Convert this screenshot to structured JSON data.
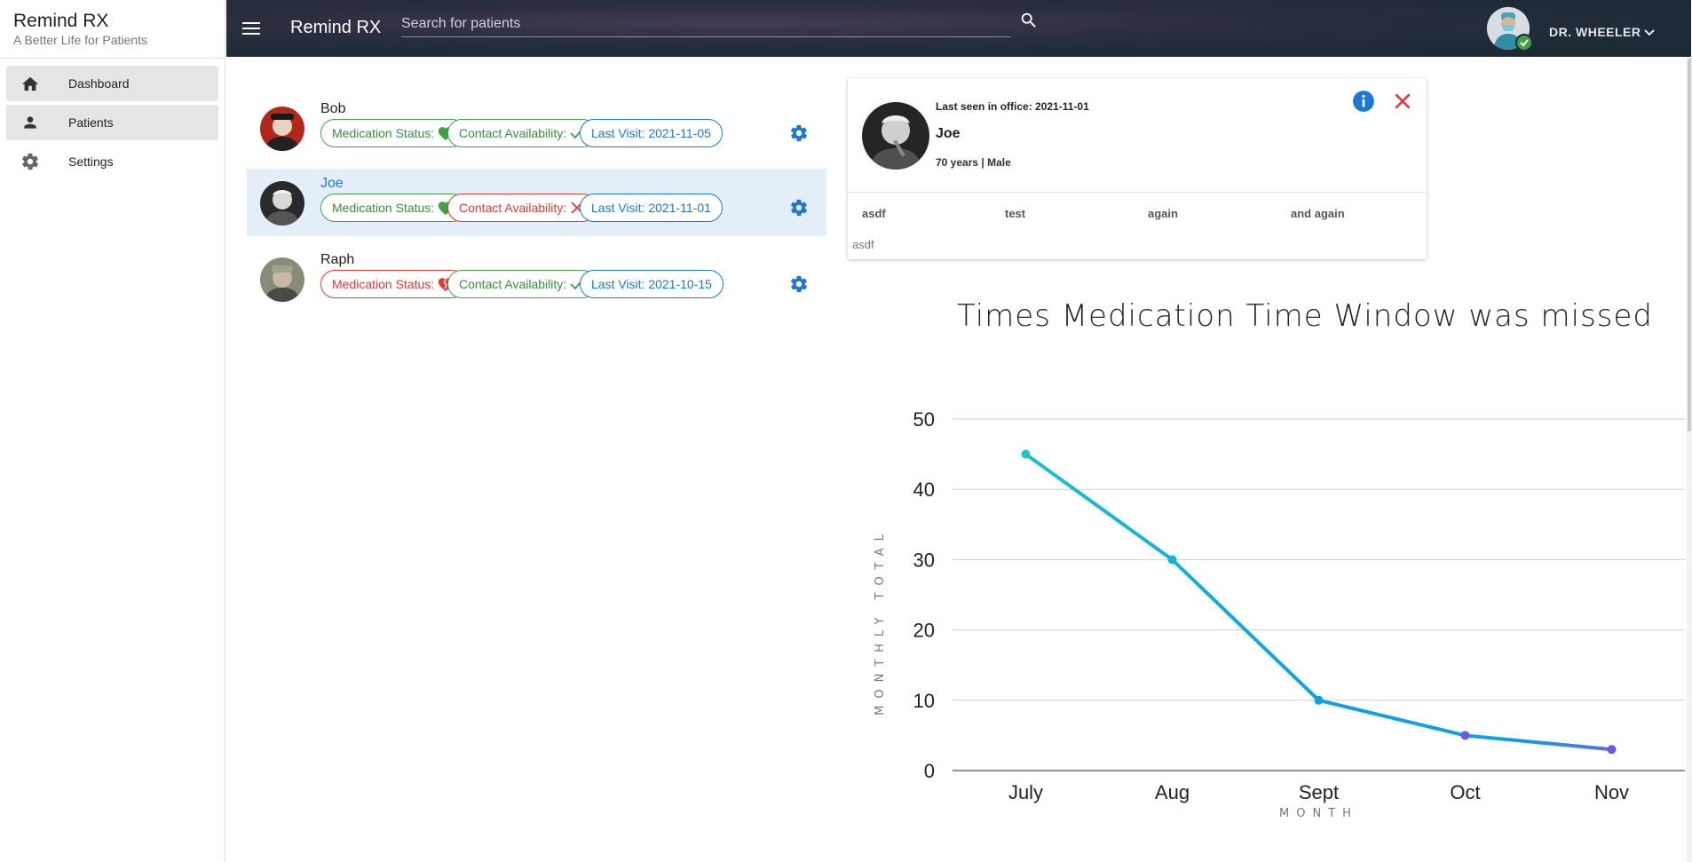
{
  "app": {
    "title": "Remind RX",
    "subtitle": "A Better Life for Patients"
  },
  "sidebar": {
    "items": [
      {
        "label": "Dashboard",
        "icon": "home-icon",
        "active": true
      },
      {
        "label": "Patients",
        "icon": "person-icon",
        "active": true
      },
      {
        "label": "Settings",
        "icon": "gear-icon",
        "active": false
      }
    ]
  },
  "topbar": {
    "title": "Remind RX",
    "search_placeholder": "Search for patients",
    "user_name": "DR. WHEELER"
  },
  "patients": [
    {
      "name": "Bob",
      "medication_label": "Medication Status:",
      "medication_ok": true,
      "contact_label": "Contact Availability:",
      "contact_ok": true,
      "last_visit": "Last Visit: 2021-11-05",
      "selected": false
    },
    {
      "name": "Joe",
      "medication_label": "Medication Status:",
      "medication_ok": true,
      "contact_label": "Contact Availability:",
      "contact_ok": false,
      "last_visit": "Last Visit: 2021-11-01",
      "selected": true
    },
    {
      "name": "Raph",
      "medication_label": "Medication Status:",
      "medication_ok": false,
      "contact_label": "Contact Availability:",
      "contact_ok": true,
      "last_visit": "Last Visit: 2021-10-15",
      "selected": false
    }
  ],
  "patient_card": {
    "last_seen": "Last seen in office: 2021-11-01",
    "name": "Joe",
    "meta": "70 years | Male",
    "tabs": [
      "asdf",
      "test",
      "again",
      "and again"
    ],
    "body": "asdf"
  },
  "colors": {
    "green": "#43a047",
    "red": "#e53935",
    "blue": "#1e78d2",
    "line_start": "#1ec8c8",
    "line_mid": "#0fa0e6",
    "line_end": "#7a52e0"
  },
  "chart_data": {
    "type": "line",
    "title": "Times Medication Time Window was missed",
    "xlabel": "MONTH",
    "ylabel": "MONTHLY TOTAL",
    "categories": [
      "July",
      "Aug",
      "Sept",
      "Oct",
      "Nov"
    ],
    "values": [
      45,
      30,
      10,
      5,
      3
    ],
    "ylim": [
      0,
      50
    ],
    "yticks": [
      0,
      10,
      20,
      30,
      40,
      50
    ],
    "grid": true
  }
}
